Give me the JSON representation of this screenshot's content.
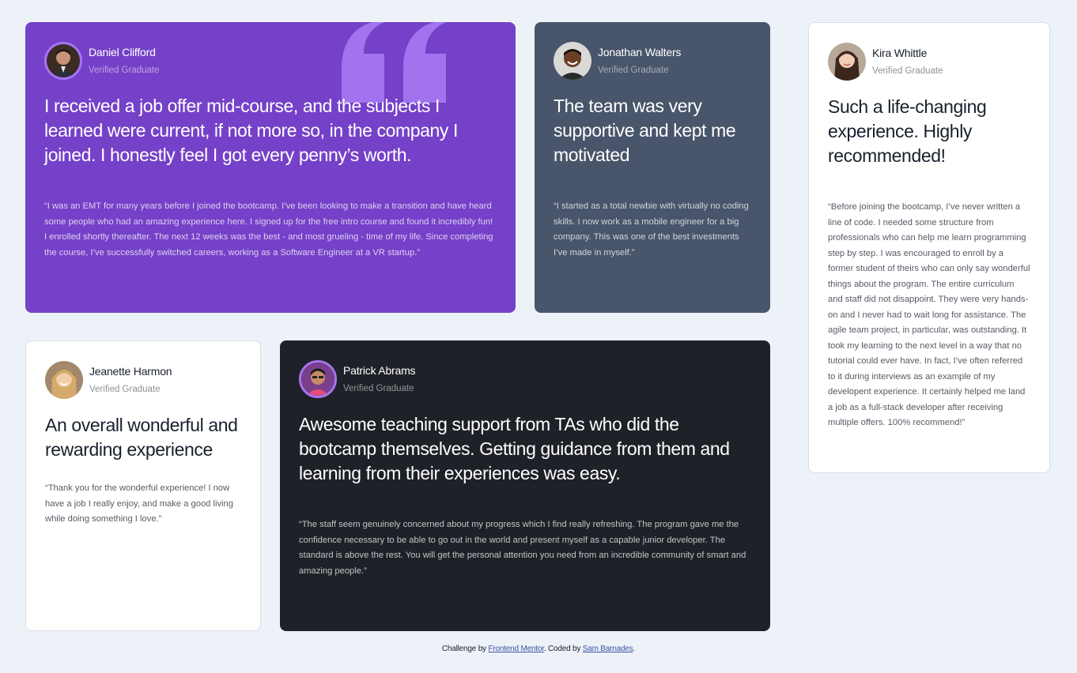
{
  "colors": {
    "page_bg": "#edf2f8",
    "purple": "#7541c8",
    "slate": "#48556a",
    "dark": "#1f2128",
    "white": "#ffffff",
    "avatar_ring": "#a775f1"
  },
  "testimonials": [
    {
      "name": "Daniel Clifford",
      "role": "Verified Graduate",
      "avatar": "avatar-daniel",
      "summary": "I received a job offer mid-course, and the subjects I learned were current, if not more so, in the company I joined. I honestly feel I got every penny’s worth.",
      "body": "“I was an EMT for many years before I joined the bootcamp. I’ve been looking to make a transition and have heard some people who had an amazing experience here. I signed up for the free intro course and found it incredibly fun! I enrolled shortly thereafter. The next 12 weeks was the best - and most grueling - time of my life. Since completing the course, I’ve successfully switched careers, working as a Software Engineer at a VR startup.”"
    },
    {
      "name": "Jonathan Walters",
      "role": "Verified Graduate",
      "avatar": "avatar-jonathan",
      "summary": "The team was very supportive and kept me motivated",
      "body": "“I started as a total newbie with virtually no coding skills. I now work as a mobile engineer for a big company. This was one of the best investments I’ve made in myself.”"
    },
    {
      "name": "Kira Whittle",
      "role": "Verified Graduate",
      "avatar": "avatar-kira",
      "summary": "Such a life-changing experience. Highly recommended!",
      "body": "“Before joining the bootcamp, I’ve never written a line of code. I needed some structure from professionals who can help me learn programming step by step. I was encouraged to enroll by a former student of theirs who can only say wonderful things about the program. The entire curriculum and staff did not disappoint. They were very hands-on and I never had to wait long for assistance. The agile team project, in particular, was outstanding. It took my learning to the next level in a way that no tutorial could ever have. In fact, I’ve often referred to it during interviews as an example of my developent experience. It certainly helped me land a job as a full-stack developer after receiving multiple offers. 100% recommend!”"
    },
    {
      "name": "Jeanette Harmon",
      "role": "Verified Graduate",
      "avatar": "avatar-jeanette",
      "summary": "An overall wonderful and rewarding experience",
      "body": "“Thank you for the wonderful experience! I now have a job I really enjoy, and make a good living while doing something I love.”"
    },
    {
      "name": "Patrick Abrams",
      "role": "Verified Graduate",
      "avatar": "avatar-patrick",
      "summary": "Awesome teaching support from TAs who did the bootcamp themselves. Getting guidance from them and learning from their experiences was easy.",
      "body": "“The staff seem genuinely concerned about my progress which I find really refreshing. The program gave me the confidence necessary to be able to go out in the world and present myself as a capable junior developer. The standard is above the rest. You will get the personal attention you need from an incredible community of smart and amazing people.”"
    }
  ],
  "footer": {
    "prefix": "Challenge by ",
    "challenge_link": "Frontend Mentor",
    "middle": ". Coded by ",
    "author_link": "Sam Barnades",
    "suffix": "."
  }
}
